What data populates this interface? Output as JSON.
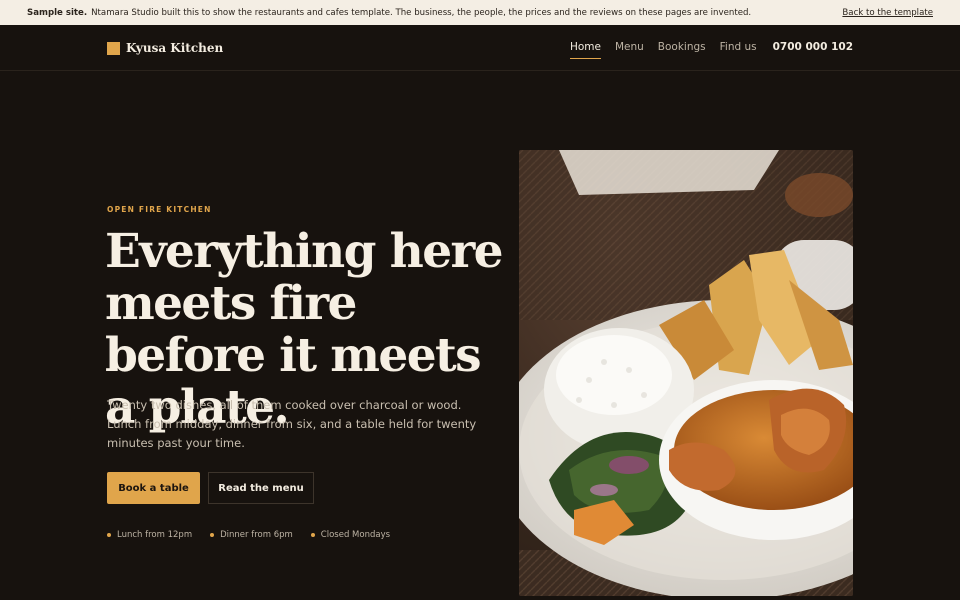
{
  "banner": {
    "lead": "Sample site.",
    "text": "Ntamara Studio built this to show the restaurants and cafes template. The business, the people, the prices and the reviews on these pages are invented.",
    "back_link": "Back to the template"
  },
  "nav": {
    "brand": "Kyusa Kitchen",
    "links": [
      "Home",
      "Menu",
      "Bookings",
      "Find us"
    ],
    "active": "Home",
    "phone": "0700 000 102"
  },
  "hero": {
    "eyebrow": "OPEN FIRE KITCHEN",
    "headline": "Everything here meets fire before it meets a plate.",
    "lede": "Twenty two dishes, all of them cooked over charcoal or wood. Lunch from midday, dinner from six, and a table held for twenty minutes past your time.",
    "primary_cta": "Book a table",
    "secondary_cta": "Read the menu",
    "hours": [
      "Lunch from 12pm",
      "Dinner from 6pm",
      "Closed Mondays"
    ]
  },
  "colors": {
    "background": "#17120e",
    "accent": "#e0a54b",
    "banner": "#f4eee4"
  }
}
